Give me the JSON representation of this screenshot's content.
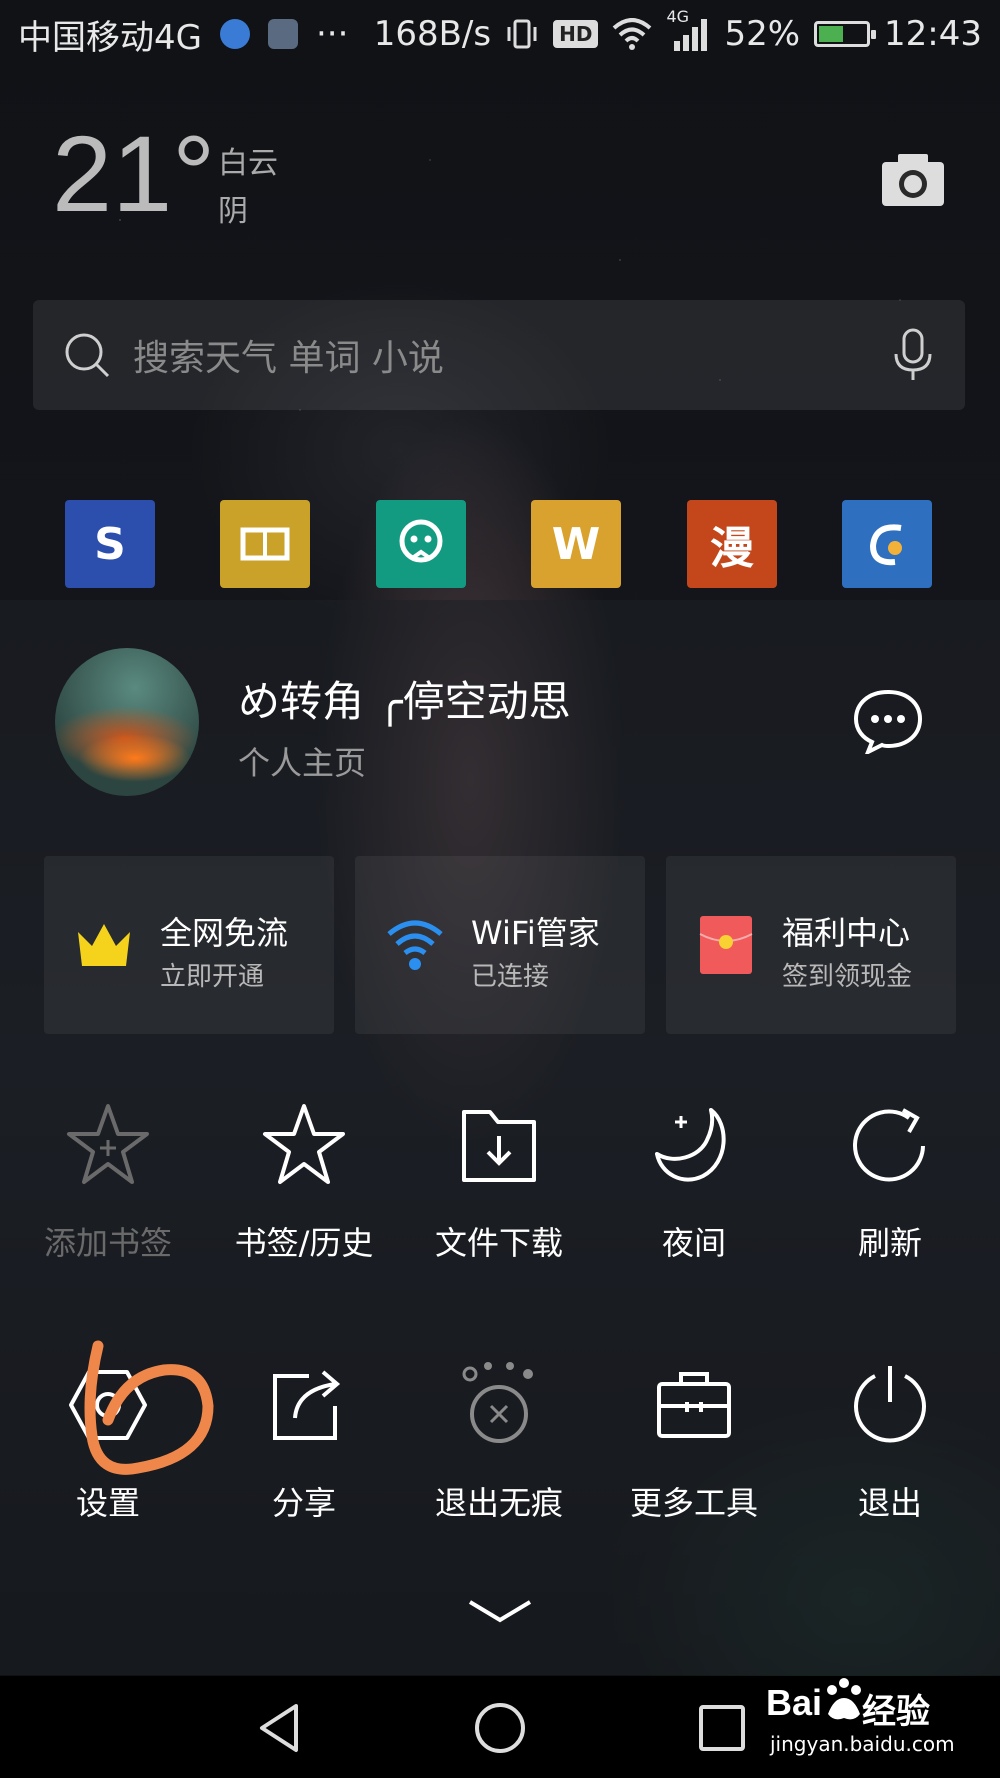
{
  "status_bar": {
    "carrier": "中国移动4G",
    "more": "···",
    "speed": "168B/s",
    "hd": "HD",
    "network": "4G",
    "battery": "52%",
    "battery_level": 0.52,
    "time": "12:43"
  },
  "weather": {
    "temperature": "21°",
    "location": "白云",
    "condition": "阴"
  },
  "search": {
    "placeholder": "搜索天气 单词 小说",
    "icons": [
      "search-icon",
      "microphone-icon",
      "camera-icon"
    ]
  },
  "quick_apps": [
    {
      "name": "sohu",
      "glyph": "S",
      "color": "#2c4fae"
    },
    {
      "name": "reader",
      "glyph": "",
      "color": "#caa22a"
    },
    {
      "name": "ghost",
      "glyph": "",
      "color": "#139b82"
    },
    {
      "name": "crown-w",
      "glyph": "W",
      "color": "#d9a12e"
    },
    {
      "name": "comic",
      "glyph": "漫",
      "color": "#c4471c"
    },
    {
      "name": "dolphin",
      "glyph": "",
      "color": "#2f6fbf"
    }
  ],
  "profile": {
    "username": "め转角 ╭停空动思",
    "subtitle": "个人主页"
  },
  "cards": [
    {
      "title": "全网免流",
      "subtitle": "立即开通",
      "icon": "crown-icon",
      "color": "#f5d21b"
    },
    {
      "title": "WiFi管家",
      "subtitle": "已连接",
      "icon": "wifi-icon",
      "color": "#2b8ff0"
    },
    {
      "title": "福利中心",
      "subtitle": "签到领现金",
      "icon": "red-envelope-icon",
      "color": "#f05a5a"
    }
  ],
  "tools_row1": [
    {
      "label": "添加书签",
      "icon": "star-plus-icon",
      "enabled": false
    },
    {
      "label": "书签/历史",
      "icon": "star-icon",
      "enabled": true
    },
    {
      "label": "文件下载",
      "icon": "download-folder-icon",
      "enabled": true
    },
    {
      "label": "夜间",
      "icon": "moon-icon",
      "enabled": true
    },
    {
      "label": "刷新",
      "icon": "refresh-icon",
      "enabled": true
    }
  ],
  "tools_row2": [
    {
      "label": "设置",
      "icon": "gear-icon",
      "enabled": true
    },
    {
      "label": "分享",
      "icon": "share-icon",
      "enabled": true
    },
    {
      "label": "退出无痕",
      "icon": "incognito-exit-icon",
      "enabled": true
    },
    {
      "label": "更多工具",
      "icon": "toolbox-icon",
      "enabled": true
    },
    {
      "label": "退出",
      "icon": "power-icon",
      "enabled": true
    }
  ],
  "watermark": {
    "logo": "Bai",
    "text": "经验",
    "url": "jingyan.baidu.com"
  },
  "annotation_color": "#f0874a"
}
